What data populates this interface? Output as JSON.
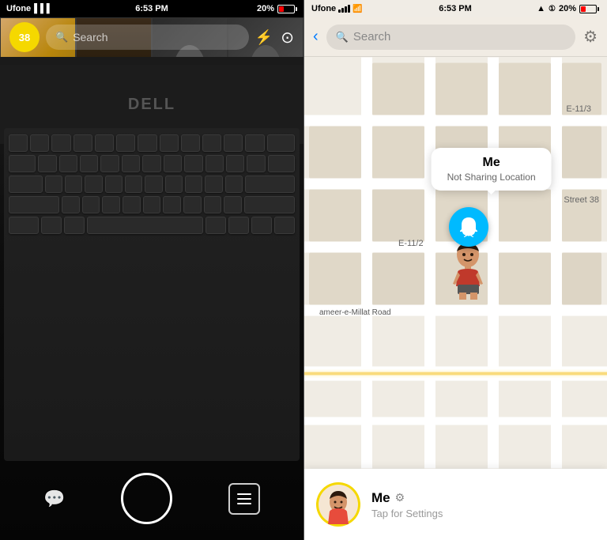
{
  "left": {
    "status_bar": {
      "carrier": "Ufone",
      "time": "6:53 PM",
      "signal": "▌▌▌",
      "battery_pct": "20%"
    },
    "header": {
      "avatar_number": "38",
      "search_placeholder": "Search"
    },
    "icons": {
      "flash": "⚡",
      "camera_rotate": "⊙",
      "search": "🔍"
    },
    "controls": {
      "chat_icon": "💬",
      "friends_icon": "••"
    }
  },
  "right": {
    "status_bar": {
      "carrier": "Ufone",
      "time": "6:53 PM",
      "battery_pct": "20%",
      "wifi": "WiFi",
      "gps": "▲"
    },
    "header": {
      "search_placeholder": "Search"
    },
    "map": {
      "label1": "E-11/3",
      "label2": "E-11/2",
      "label3": "Street 38",
      "road": "ameer-e-Millat Road"
    },
    "popup": {
      "name": "Me",
      "status": "Not Sharing Location"
    },
    "profile": {
      "name": "Me",
      "subtitle": "Tap for Settings"
    }
  }
}
